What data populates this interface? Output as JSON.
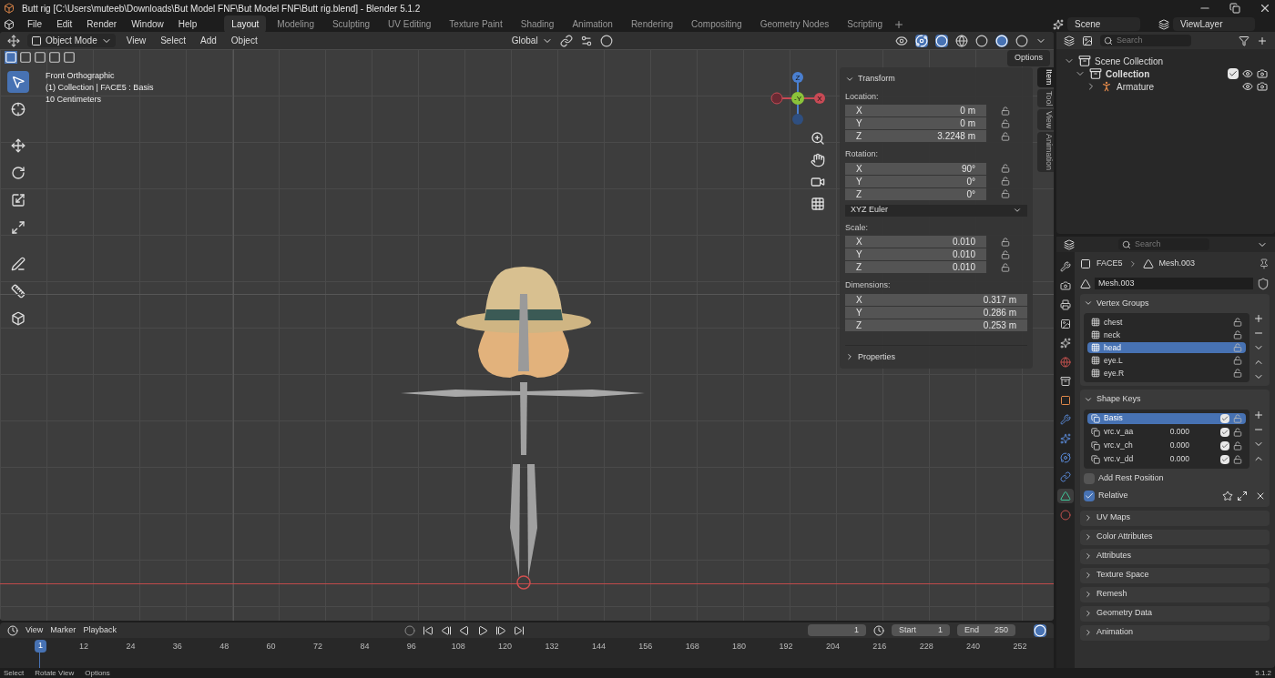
{
  "window": {
    "title": "Butt rig [C:\\Users\\muteeb\\Downloads\\But Model FNF\\But Model FNF\\Butt rig.blend] - Blender 5.1.2"
  },
  "menu": [
    "File",
    "Edit",
    "Render",
    "Window",
    "Help"
  ],
  "workspaces": [
    {
      "label": "Layout",
      "selected": true
    },
    {
      "label": "Modeling",
      "selected": false
    },
    {
      "label": "Sculpting",
      "selected": false
    },
    {
      "label": "UV Editing",
      "selected": false
    },
    {
      "label": "Texture Paint",
      "selected": false
    },
    {
      "label": "Shading",
      "selected": false
    },
    {
      "label": "Animation",
      "selected": false
    },
    {
      "label": "Rendering",
      "selected": false
    },
    {
      "label": "Compositing",
      "selected": false
    },
    {
      "label": "Geometry Nodes",
      "selected": false
    },
    {
      "label": "Scripting",
      "selected": false
    }
  ],
  "scene": "Scene",
  "view_layer": "ViewLayer",
  "viewport": {
    "mode": "Object Mode",
    "menus": [
      "View",
      "Select",
      "Add",
      "Object"
    ],
    "orientation": "Global",
    "options": "Options",
    "overlay_text": [
      "Front Orthographic",
      "(1) Collection | FACE5 : Basis",
      "10 Centimeters"
    ],
    "gizmo": {
      "z": "Z",
      "y": "-Y",
      "x": "X"
    }
  },
  "sidebar": {
    "tabs": [
      {
        "label": "Item",
        "selected": true
      },
      {
        "label": "Tool",
        "selected": false
      },
      {
        "label": "View",
        "selected": false
      },
      {
        "label": "Animation",
        "selected": false
      }
    ],
    "panel": "Transform",
    "groups": [
      {
        "label": "Location:",
        "lockable": true,
        "fields": [
          {
            "axis": "X",
            "value": "0 m"
          },
          {
            "axis": "Y",
            "value": "0 m"
          },
          {
            "axis": "Z",
            "value": "3.2248 m"
          }
        ]
      },
      {
        "label": "Rotation:",
        "lockable": true,
        "fields": [
          {
            "axis": "X",
            "value": "90°"
          },
          {
            "axis": "Y",
            "value": "0°"
          },
          {
            "axis": "Z",
            "value": "0°"
          }
        ],
        "mode": "XYZ Euler"
      },
      {
        "label": "Scale:",
        "lockable": true,
        "fields": [
          {
            "axis": "X",
            "value": "0.010"
          },
          {
            "axis": "Y",
            "value": "0.010"
          },
          {
            "axis": "Z",
            "value": "0.010"
          }
        ]
      },
      {
        "label": "Dimensions:",
        "lockable": false,
        "fields": [
          {
            "axis": "X",
            "value": "0.317 m"
          },
          {
            "axis": "Y",
            "value": "0.286 m"
          },
          {
            "axis": "Z",
            "value": "0.253 m"
          }
        ]
      }
    ],
    "collapsed_panel": "Properties"
  },
  "outliner": {
    "search": {
      "placeholder": "Search"
    },
    "tree": [
      {
        "label": "Scene Collection",
        "expanded": true,
        "children": [
          {
            "label": "Collection",
            "expanded": true,
            "checked": true,
            "children": [
              {
                "label": "Armature",
                "expanded": false
              }
            ]
          }
        ]
      }
    ]
  },
  "properties": {
    "search": {
      "placeholder": "Search"
    },
    "tabs": [
      {
        "kind": "tool",
        "selected": false
      },
      {
        "kind": "render",
        "selected": false
      },
      {
        "kind": "output",
        "selected": false
      },
      {
        "kind": "view",
        "selected": false
      },
      {
        "kind": "scene",
        "selected": false
      },
      {
        "kind": "world",
        "selected": false
      },
      {
        "kind": "collection",
        "selected": false
      },
      {
        "kind": "object",
        "selected": false
      },
      {
        "kind": "modifier",
        "selected": false
      },
      {
        "kind": "particles",
        "selected": false
      },
      {
        "kind": "physics",
        "selected": false
      },
      {
        "kind": "constraints",
        "selected": false
      },
      {
        "kind": "data",
        "selected": true
      },
      {
        "kind": "material",
        "selected": false
      }
    ],
    "breadcrumb": [
      "FACE5",
      "Mesh.003"
    ],
    "data_name": "Mesh.003",
    "vertex_groups": {
      "title": "Vertex Groups",
      "items": [
        {
          "name": "chest",
          "selected": false
        },
        {
          "name": "neck",
          "selected": false
        },
        {
          "name": "head",
          "selected": true
        },
        {
          "name": "eye.L",
          "selected": false
        },
        {
          "name": "eye.R",
          "selected": false
        }
      ]
    },
    "shape_keys": {
      "title": "Shape Keys",
      "items": [
        {
          "name": "Basis",
          "selected": true,
          "enabled": true
        },
        {
          "name": "vrc.v_aa",
          "value": "0.000",
          "selected": false,
          "enabled": true
        },
        {
          "name": "vrc.v_ch",
          "value": "0.000",
          "selected": false,
          "enabled": true
        },
        {
          "name": "vrc.v_dd",
          "value": "0.000",
          "selected": false,
          "enabled": true
        }
      ],
      "options": [
        {
          "label": "Add Rest Position",
          "checked": false
        },
        {
          "label": "Relative",
          "checked": true
        }
      ]
    },
    "panels": [
      "UV Maps",
      "Color Attributes",
      "Attributes",
      "Texture Space",
      "Remesh",
      "Geometry Data",
      "Animation"
    ]
  },
  "timeline": {
    "menus": [
      "View",
      "Marker",
      "Playback"
    ],
    "frame": "1",
    "start_label": "Start",
    "start": "1",
    "end_label": "End",
    "end": "250",
    "current": "1",
    "ticks": [
      "12",
      "24",
      "36",
      "48",
      "60",
      "72",
      "84",
      "96",
      "108",
      "120",
      "132",
      "144",
      "156",
      "168",
      "180",
      "192",
      "204",
      "216",
      "228",
      "240",
      "252"
    ]
  },
  "status_bar": {
    "hints": [
      "Select",
      "Rotate View",
      "Options"
    ],
    "version": "5.1.2"
  }
}
